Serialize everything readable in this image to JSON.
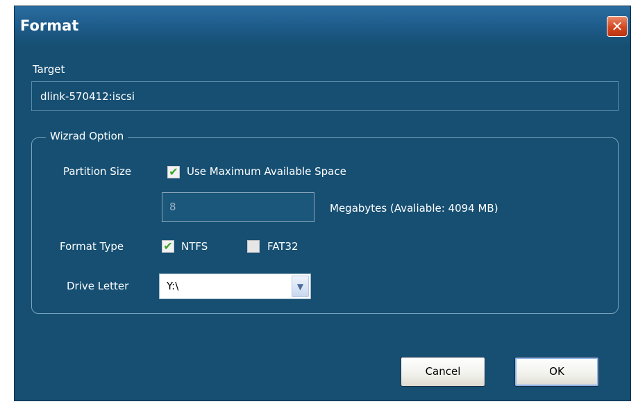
{
  "window": {
    "title": "Format",
    "close_glyph": "✕"
  },
  "target": {
    "label": "Target",
    "value": "dlink-570412:iscsi"
  },
  "wizard": {
    "legend": "Wizrad Option",
    "partition_size_label": "Partition Size",
    "use_max_label": "Use Maximum Available Space",
    "use_max_checked": true,
    "size_value": "8",
    "size_unit_label": "Megabytes (Avaliable: 4094 MB)",
    "format_type_label": "Format Type",
    "ntfs_label": "NTFS",
    "ntfs_checked": true,
    "fat32_label": "FAT32",
    "fat32_checked": false,
    "drive_letter_label": "Drive Letter",
    "drive_letter_value": "Y:\\"
  },
  "buttons": {
    "cancel": "Cancel",
    "ok": "OK"
  },
  "icons": {
    "check_glyph": "✔",
    "dropdown_glyph": "▼"
  },
  "colors": {
    "window_bg": "#164f72",
    "titlebar": "#1c5a88",
    "close_button": "#d2471f",
    "check_green": "#3aa32a"
  }
}
